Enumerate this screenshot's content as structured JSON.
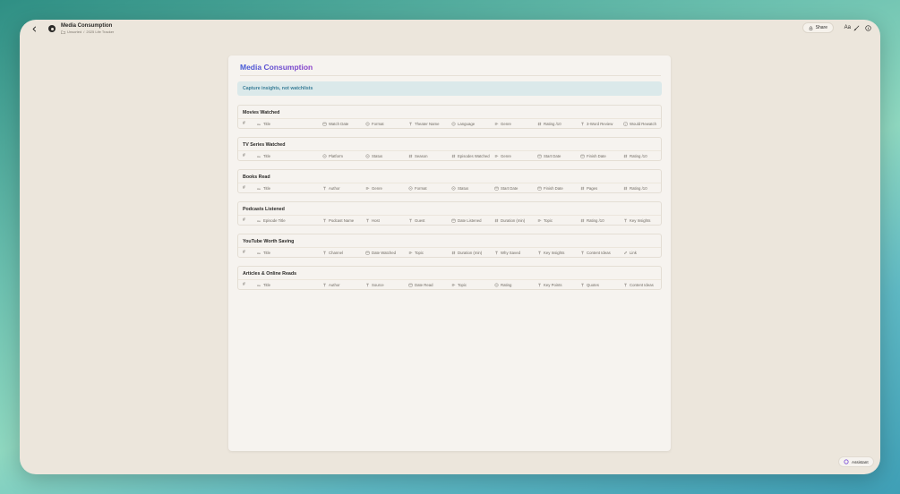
{
  "header": {
    "doc_title": "Media Consumption",
    "breadcrumb": [
      "Unsorted",
      "2025 Life Tracker"
    ],
    "share_label": "Share",
    "font_label": "Aa"
  },
  "page": {
    "title": "Media Consumption",
    "callout": "Capture insights, not watchlists"
  },
  "databases": [
    {
      "title": "Movies Watched",
      "columns": [
        {
          "icon": "hash",
          "label": "#"
        },
        {
          "icon": "text-aa",
          "label": "Title"
        },
        {
          "icon": "calendar",
          "label": "Watch Date"
        },
        {
          "icon": "select",
          "label": "Format"
        },
        {
          "icon": "text-t",
          "label": "Theater Name"
        },
        {
          "icon": "select",
          "label": "Language"
        },
        {
          "icon": "multi-select",
          "label": "Genre"
        },
        {
          "icon": "number",
          "label": "Rating /10"
        },
        {
          "icon": "text-t",
          "label": "3-Word Review"
        },
        {
          "icon": "checkbox",
          "label": "Would Rewatch"
        }
      ]
    },
    {
      "title": "TV Series Watched",
      "columns": [
        {
          "icon": "hash",
          "label": "#"
        },
        {
          "icon": "text-aa",
          "label": "Title"
        },
        {
          "icon": "select",
          "label": "Platform"
        },
        {
          "icon": "select",
          "label": "Status"
        },
        {
          "icon": "number",
          "label": "Season"
        },
        {
          "icon": "number",
          "label": "Episodes Watched"
        },
        {
          "icon": "multi-select",
          "label": "Genre"
        },
        {
          "icon": "calendar",
          "label": "Start Date"
        },
        {
          "icon": "calendar",
          "label": "Finish Date"
        },
        {
          "icon": "number",
          "label": "Rating /10"
        }
      ]
    },
    {
      "title": "Books Read",
      "columns": [
        {
          "icon": "hash",
          "label": "#"
        },
        {
          "icon": "text-aa",
          "label": "Title"
        },
        {
          "icon": "text-t",
          "label": "Author"
        },
        {
          "icon": "multi-select",
          "label": "Genre"
        },
        {
          "icon": "select",
          "label": "Format"
        },
        {
          "icon": "select",
          "label": "Status"
        },
        {
          "icon": "calendar",
          "label": "Start Date"
        },
        {
          "icon": "calendar",
          "label": "Finish Date"
        },
        {
          "icon": "number",
          "label": "Pages"
        },
        {
          "icon": "number",
          "label": "Rating /10"
        }
      ]
    },
    {
      "title": "Podcasts Listened",
      "columns": [
        {
          "icon": "hash",
          "label": "#"
        },
        {
          "icon": "text-aa",
          "label": "Episode Title"
        },
        {
          "icon": "text-t",
          "label": "Podcast Name"
        },
        {
          "icon": "text-t",
          "label": "Host"
        },
        {
          "icon": "text-t",
          "label": "Guest"
        },
        {
          "icon": "calendar",
          "label": "Date Listened"
        },
        {
          "icon": "number",
          "label": "Duration (min)"
        },
        {
          "icon": "multi-select",
          "label": "Topic"
        },
        {
          "icon": "number",
          "label": "Rating /10"
        },
        {
          "icon": "text-t",
          "label": "Key Insights"
        }
      ]
    },
    {
      "title": "YouTube Worth Saving",
      "columns": [
        {
          "icon": "hash",
          "label": "#"
        },
        {
          "icon": "text-aa",
          "label": "Title"
        },
        {
          "icon": "text-t",
          "label": "Channel"
        },
        {
          "icon": "calendar",
          "label": "Date Watched"
        },
        {
          "icon": "multi-select",
          "label": "Topic"
        },
        {
          "icon": "number",
          "label": "Duration (min)"
        },
        {
          "icon": "text-t",
          "label": "Why Saved"
        },
        {
          "icon": "text-t",
          "label": "Key Insights"
        },
        {
          "icon": "text-t",
          "label": "Content Ideas"
        },
        {
          "icon": "link",
          "label": "Link"
        }
      ]
    },
    {
      "title": "Articles & Online Reads",
      "columns": [
        {
          "icon": "hash",
          "label": "#"
        },
        {
          "icon": "text-aa",
          "label": "Title"
        },
        {
          "icon": "text-t",
          "label": "Author"
        },
        {
          "icon": "text-t",
          "label": "Source"
        },
        {
          "icon": "calendar",
          "label": "Date Read"
        },
        {
          "icon": "multi-select",
          "label": "Topic"
        },
        {
          "icon": "select",
          "label": "Rating"
        },
        {
          "icon": "text-t",
          "label": "Key Points"
        },
        {
          "icon": "text-t",
          "label": "Quotes"
        },
        {
          "icon": "text-t",
          "label": "Content Ideas"
        }
      ]
    }
  ],
  "assistant_label": "Assistant"
}
